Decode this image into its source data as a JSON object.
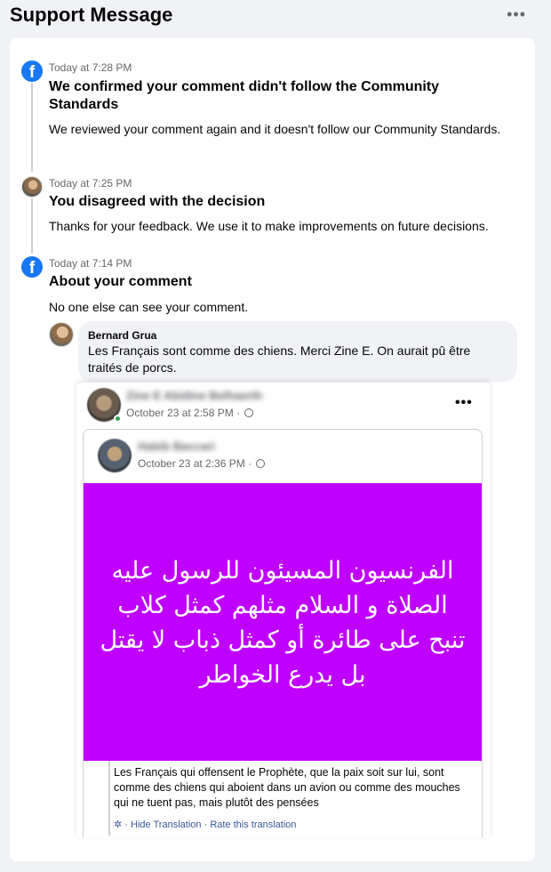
{
  "header": {
    "title": "Support Message",
    "more": "•••"
  },
  "messages": [
    {
      "time": "Today at 7:28 PM",
      "title": "We confirmed your comment didn't follow the Community Standards",
      "body_prefix": "We reviewed your comment again and it doesn't follow our",
      "body_link": "Community Standards",
      "body_suffix": ".",
      "icon": "facebook-icon"
    },
    {
      "time": "Today at 7:25 PM",
      "title": "You disagreed with the decision",
      "body": "Thanks for your feedback. We use it to make improvements on future decisions.",
      "icon": "user-avatar"
    },
    {
      "time": "Today at 7:14 PM",
      "title": "About your comment",
      "body": "No one else can see your comment.",
      "icon": "facebook-icon"
    }
  ],
  "comment": {
    "author": "Bernard Grua",
    "text": "Les Français sont comme des chiens. Merci Zine E. On aurait pû être traités de porcs."
  },
  "shared_post": {
    "author_blurred": "Zine E Abidine Belhaerth",
    "time": "October 23 at 2:58 PM ·",
    "more": "•••",
    "inner": {
      "author_blurred": "Habib Baccari",
      "time": "October 23 at 2:36 PM ·",
      "background_color": "#bf00ff",
      "arabic_text": "الفرنسيون المسيئون للرسول عليه الصلاة و السلام مثلهم كمثل كلاب تنبح على طائرة أو كمثل ذباب لا يقتل بل يدرع الخواطر",
      "translation": "Les Français qui offensent le Prophète, que la paix soit sur lui, sont comme des chiens qui aboient dans un avion ou comme des mouches qui ne tuent pas, mais plutôt des pensées",
      "hide_translation": "Hide Translation",
      "separator": "·",
      "rate_translation": "Rate this translation"
    }
  },
  "colors": {
    "facebook_blue": "#1877f2",
    "link": "#385898",
    "secondary_text": "#65676b",
    "magenta": "#bf00ff"
  }
}
